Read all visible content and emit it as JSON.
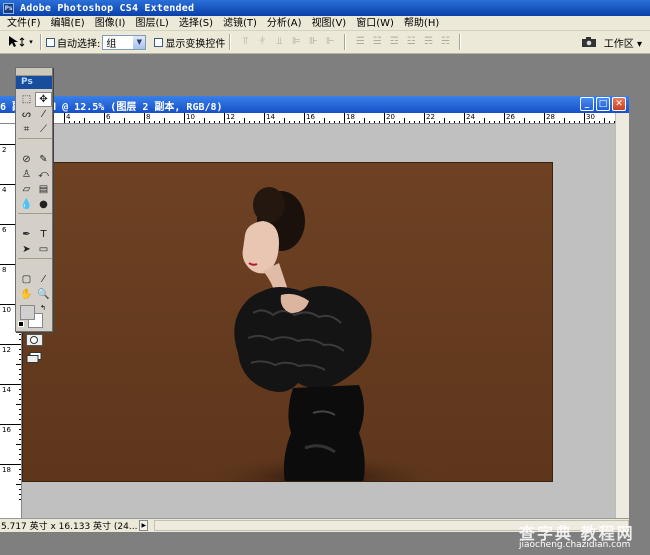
{
  "app": {
    "title": "Adobe Photoshop CS4 Extended",
    "icon_text": "Ps"
  },
  "menu": [
    "文件(F)",
    "编辑(E)",
    "图像(I)",
    "图层(L)",
    "选择(S)",
    "滤镜(T)",
    "分析(A)",
    "视图(V)",
    "窗口(W)",
    "帮助(H)"
  ],
  "options": {
    "tool_icon": "move-tool-icon",
    "auto_select_label": "自动选择:",
    "auto_select_value": "组",
    "show_transform_label": "显示变换控件",
    "workspace_label": "工作区 ▾"
  },
  "document": {
    "title": "6 副本.psd @ 12.5% (图层 2 副本, RGB/8)",
    "ruler_top": [
      "4",
      "6",
      "8",
      "10",
      "12",
      "14",
      "16",
      "18",
      "20",
      "22",
      "24",
      "26",
      "28",
      "30"
    ],
    "ruler_left": [
      "2",
      "4",
      "6",
      "8",
      "10",
      "12",
      "14",
      "16",
      "18"
    ],
    "status_text": "5.717 英寸 x 16.133 英寸 (24...",
    "background_color": "#6b3f21"
  },
  "toolbox": {
    "header": "Ps",
    "tools": [
      {
        "name": "marquee-tool-icon",
        "glyph": "⬚"
      },
      {
        "name": "move-tool-icon",
        "glyph": "✥"
      },
      {
        "name": "lasso-tool-icon",
        "glyph": "ᔕ"
      },
      {
        "name": "magic-wand-tool-icon",
        "glyph": "⁄"
      },
      {
        "name": "crop-tool-icon",
        "glyph": "⌗"
      },
      {
        "name": "slice-tool-icon",
        "glyph": "⟋"
      },
      {
        "name": "healing-brush-icon",
        "glyph": "⊘"
      },
      {
        "name": "brush-tool-icon",
        "glyph": "✎"
      },
      {
        "name": "clone-stamp-icon",
        "glyph": "♙"
      },
      {
        "name": "history-brush-icon",
        "glyph": "⤺"
      },
      {
        "name": "eraser-tool-icon",
        "glyph": "▱"
      },
      {
        "name": "gradient-tool-icon",
        "glyph": "▤"
      },
      {
        "name": "blur-tool-icon",
        "glyph": "💧"
      },
      {
        "name": "dodge-tool-icon",
        "glyph": "●"
      },
      {
        "name": "pen-tool-icon",
        "glyph": "✒"
      },
      {
        "name": "type-tool-icon",
        "glyph": "T"
      },
      {
        "name": "path-selection-icon",
        "glyph": "➤"
      },
      {
        "name": "shape-tool-icon",
        "glyph": "▭"
      },
      {
        "name": "notes-tool-icon",
        "glyph": "▢"
      },
      {
        "name": "eyedropper-tool-icon",
        "glyph": "⁄"
      },
      {
        "name": "hand-tool-icon",
        "glyph": "✋"
      },
      {
        "name": "zoom-tool-icon",
        "glyph": "🔍"
      }
    ]
  },
  "watermark": {
    "top_text": "查字典 教程网",
    "url": "jiaocheng.chazidian.com"
  }
}
